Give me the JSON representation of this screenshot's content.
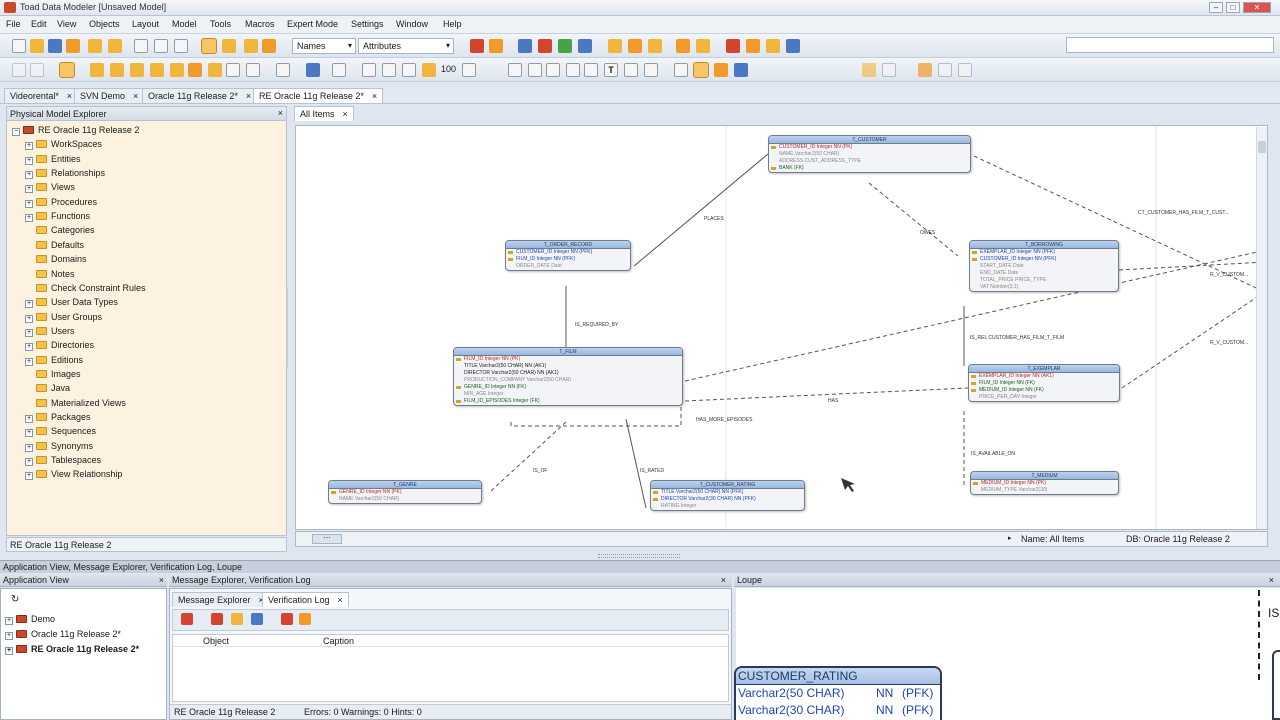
{
  "window": {
    "title": "Toad Data Modeler [Unsaved Model]",
    "controls": [
      "–",
      "□",
      "✕"
    ]
  },
  "menu": [
    "File",
    "Edit",
    "View",
    "Objects",
    "Layout",
    "Model",
    "Tools",
    "Macros",
    "Expert Mode",
    "Settings",
    "Window",
    "Help"
  ],
  "toolbar": {
    "names_combo": "Names",
    "attributes_combo": "Attributes",
    "zoom_value": "100"
  },
  "document_tabs": [
    {
      "label": "Videorental*"
    },
    {
      "label": "SVN Demo"
    },
    {
      "label": "Oracle 11g Release 2*"
    },
    {
      "label": "RE Oracle 11g Release 2*"
    }
  ],
  "explorer": {
    "header": "Physical Model Explorer",
    "root": "RE Oracle 11g Release 2",
    "items": [
      "WorkSpaces",
      "Entities",
      "Relationships",
      "Views",
      "Procedures",
      "Functions",
      "Categories",
      "Defaults",
      "Domains",
      "Notes",
      "Check Constraint Rules",
      "User Data Types",
      "User Groups",
      "Users",
      "Directories",
      "Editions",
      "Images",
      "Java",
      "Materialized Views",
      "Packages",
      "Sequences",
      "Synonyms",
      "Tablespaces",
      "View Relationship"
    ],
    "status": "RE Oracle 11g Release 2"
  },
  "canvas": {
    "tab": "All Items",
    "status_name": "Name: All Items",
    "status_db": "DB: Oracle 11g Release 2",
    "entities": {
      "customer": {
        "name": "T_CUSTOMER",
        "rows": [
          "CUSTOMER_ID   Integer   NN (PK)",
          "NAME   Varchar2(50 CHAR)",
          "ADDRESS   CUST_ADDRESS_TYPE",
          "BANK (FK)"
        ]
      },
      "order_record": {
        "name": "T_ORDER_RECORD",
        "rows": [
          "CUSTOMER_ID   Integer   NN (PFK)",
          "FILM_ID   Integer   NN (PFK)",
          "ORDER_DATE   Date"
        ]
      },
      "film": {
        "name": "T_FILM",
        "rows": [
          "FILM_ID   Integer   NN (PK)",
          "TITLE   Varchar2(50 CHAR)   NN (AK1)",
          "DIRECTOR   Varchar2(50 CHAR)   NN (AK1)",
          "PRODUCTION_COMPANY   Varchar2(50 CHAR)",
          "GENRE_ID   Integer   NN (FK)",
          "MIN_AGE   Integer",
          "FILM_ID_EPISODES   Integer   (FK)"
        ]
      },
      "genre": {
        "name": "T_GENRE",
        "rows": [
          "GENRE_ID   Integer   NN (PK)",
          "NAME   Varchar2(50 CHAR)"
        ]
      },
      "customer_rating": {
        "name": "T_CUSTOMER_RATING",
        "rows": [
          "TITLE   Varchar2(50 CHAR)   NN (PFK)",
          "DIRECTOR   Varchar2(30 CHAR)   NN (PFK)",
          "RATING   Integer"
        ]
      },
      "borrowing": {
        "name": "T_BORROWING",
        "rows": [
          "EXEMPLAR_ID   Integer   NN (PFK)",
          "CUSTOMER_ID   Integer   NN (PFK)",
          "START_DATE   Date",
          "END_DATE   Date",
          "TOTAL_PRICE   PRICE_TYPE",
          "VAT   Number(3,1)"
        ]
      },
      "exemplar": {
        "name": "T_EXEMPLAR",
        "rows": [
          "EXEMPLAR_ID   Integer   NN (AK1)",
          "FILM_ID   Integer   NN (FK)",
          "MEDIUM_ID   Integer   NN (FK)",
          "PRICE_PER_DAY   Integer"
        ]
      },
      "medium": {
        "name": "T_MEDIUM",
        "rows": [
          "MEDIUM_ID   Integer   NN (PK)",
          "MEDIUM_TYPE   Varchar2(30)"
        ]
      }
    },
    "relations": {
      "places": "PLACES",
      "is_required_by": "IS_REQUIRED_BY",
      "has_more_episodes": "HAS_MORE_EPISODES",
      "is_of": "IS_OF",
      "is_rated": "IS_RATED",
      "owes": "OWES",
      "has": "HAS",
      "cust_has_film": "CT_CUSTOMER_HAS_FILM_T_CUST...",
      "customer_has_film": "IS_REL CUSTOMER_HAS_FILM_T_FILM",
      "is_available_on": "IS_AVAILABLE_ON",
      "r_v_cust1": "R_V_CUSTOM...",
      "r_v_cust2": "R_V_CUSTOM..."
    }
  },
  "bottom": {
    "band_title": "Application View, Message Explorer, Verification Log, Loupe",
    "app_view": {
      "header": "Application View",
      "items": [
        "Demo",
        "Oracle 11g Release 2*",
        "RE Oracle 11g Release 2*"
      ]
    },
    "messages": {
      "header": "Message Explorer, Verification Log",
      "tabs": [
        "Message Explorer",
        "Verification Log"
      ],
      "columns": [
        "Object",
        "Caption"
      ],
      "status_model": "RE Oracle 11g Release 2",
      "status_counts": "Errors: 0  Warnings: 0  Hints: 0"
    },
    "loupe": {
      "header": "Loupe",
      "entity_name": "CUSTOMER_RATING",
      "rows": [
        {
          "type": "Varchar2(50 CHAR)",
          "nn": "NN",
          "key": "(PFK)"
        },
        {
          "type": "Varchar2(30 CHAR)",
          "nn": "NN",
          "key": "(PFK)"
        }
      ],
      "side_text": "IS"
    }
  }
}
